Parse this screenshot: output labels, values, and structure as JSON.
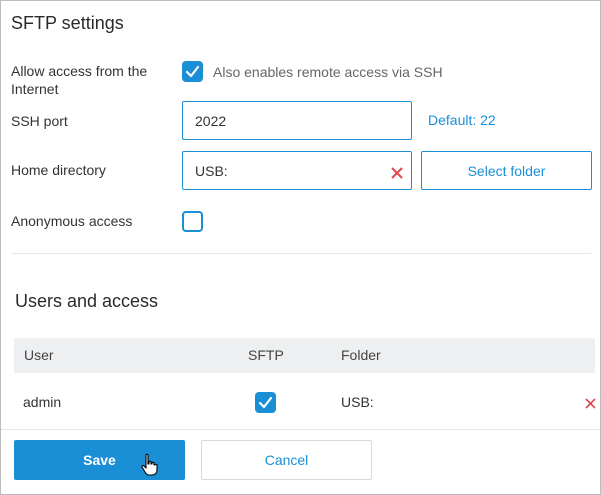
{
  "sftp": {
    "title": "SFTP settings",
    "allow_internet": {
      "label": "Allow access from the Internet",
      "checked": true,
      "hint": "Also enables remote access via SSH"
    },
    "ssh_port": {
      "label": "SSH port",
      "value": "2022",
      "default_text": "Default: 22"
    },
    "home_directory": {
      "label": "Home directory",
      "value": "USB:",
      "clear_icon": "close-icon",
      "select_button": "Select folder"
    },
    "anonymous": {
      "label": "Anonymous access",
      "checked": false
    }
  },
  "users": {
    "title": "Users and access",
    "columns": [
      "User",
      "SFTP",
      "Folder"
    ],
    "rows": [
      {
        "user": "admin",
        "sftp": true,
        "folder": "USB:"
      }
    ]
  },
  "footer": {
    "save": "Save",
    "cancel": "Cancel"
  },
  "colors": {
    "accent": "#1a8fd6",
    "danger": "#e0474c",
    "header_bg": "#eeeff1"
  }
}
